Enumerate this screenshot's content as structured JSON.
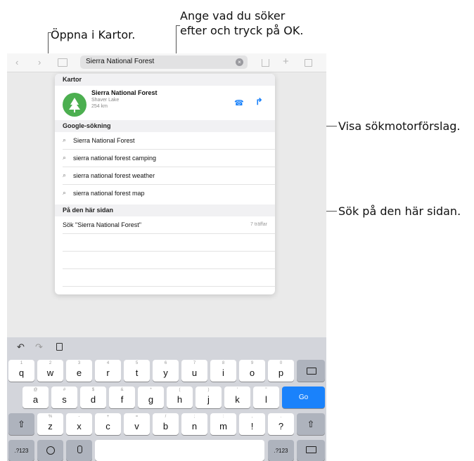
{
  "callouts": {
    "search_hint": "Ange vad du söker\nefter och tryck på OK.",
    "open_maps": "Öppna i Kartor.",
    "engine_suggestions": "Visa sökmotorförslag.",
    "find_on_page": "Sök på den här sidan."
  },
  "toolbar": {
    "address_value": "Sierra National Forest",
    "icons": [
      "back-icon",
      "forward-icon",
      "bookmarks-icon",
      "clear-icon",
      "share-icon",
      "plus-icon",
      "tabs-icon"
    ]
  },
  "suggestions": {
    "maps_header": "Kartor",
    "map_result": {
      "title": "Sierra National Forest",
      "subtitle": "Shaver Lake",
      "distance": "254 km",
      "icons": [
        "tree-icon",
        "phone-icon",
        "directions-icon"
      ]
    },
    "google_header": "Google-sökning",
    "google_items": [
      "Sierra National Forest",
      "sierra national forest camping",
      "sierra national forest weather",
      "sierra national forest map"
    ],
    "page_header": "På den här sidan",
    "page_item": {
      "label": "Sök \"Sierra National Forest\"",
      "count": "7 träffar"
    }
  },
  "keyboard": {
    "toolbar_icons": [
      "undo-icon",
      "redo-icon",
      "paste-icon"
    ],
    "row1": [
      {
        "main": "q",
        "sub": "1"
      },
      {
        "main": "w",
        "sub": "2"
      },
      {
        "main": "e",
        "sub": "3"
      },
      {
        "main": "r",
        "sub": "4"
      },
      {
        "main": "t",
        "sub": "5"
      },
      {
        "main": "y",
        "sub": "6"
      },
      {
        "main": "u",
        "sub": "7"
      },
      {
        "main": "i",
        "sub": "8"
      },
      {
        "main": "o",
        "sub": "9"
      },
      {
        "main": "p",
        "sub": "0"
      }
    ],
    "row2": [
      {
        "main": "a",
        "sub": "@"
      },
      {
        "main": "s",
        "sub": "#"
      },
      {
        "main": "d",
        "sub": "$"
      },
      {
        "main": "f",
        "sub": "&"
      },
      {
        "main": "g",
        "sub": "*"
      },
      {
        "main": "h",
        "sub": "("
      },
      {
        "main": "j",
        "sub": ")"
      },
      {
        "main": "k",
        "sub": "'"
      },
      {
        "main": "l",
        "sub": "\""
      }
    ],
    "row3": [
      {
        "main": "z",
        "sub": "%"
      },
      {
        "main": "x",
        "sub": "-"
      },
      {
        "main": "c",
        "sub": "+"
      },
      {
        "main": "v",
        "sub": "="
      },
      {
        "main": "b",
        "sub": "/"
      },
      {
        "main": "n",
        "sub": ";"
      },
      {
        "main": "m",
        "sub": ":"
      },
      {
        "main": "!",
        "sub": ","
      },
      {
        "main": "?",
        "sub": "."
      }
    ],
    "go_label": "Go",
    "numbers_label": ".?123",
    "accent_color": "#1a82fb"
  }
}
